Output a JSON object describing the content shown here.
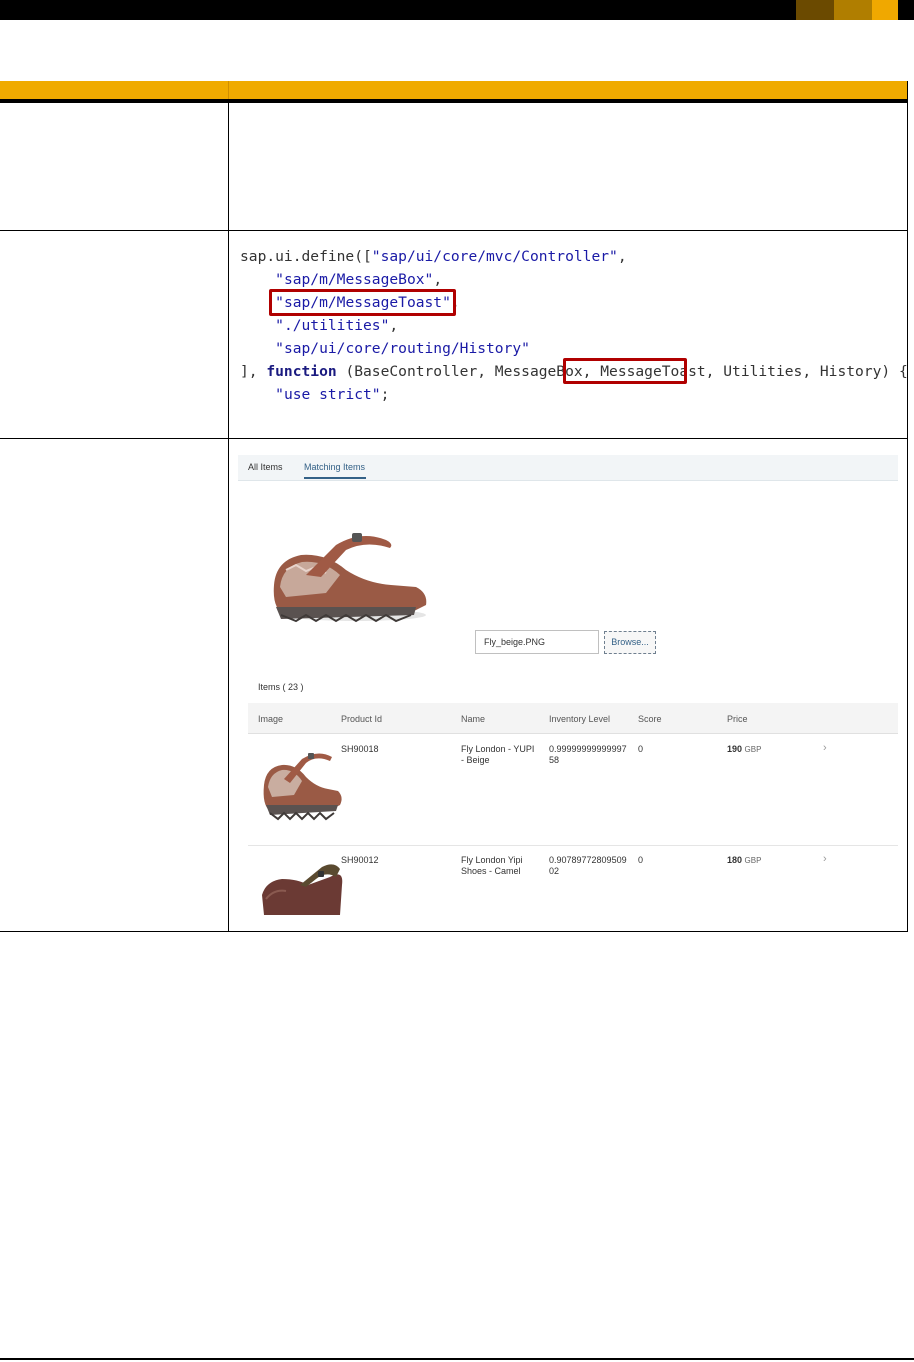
{
  "code": {
    "lines": [
      [
        {
          "t": "sap.ui.define(["
        },
        {
          "t": "\"sap/ui/core/mvc/Controller\"",
          "c": "str"
        },
        {
          "t": ","
        }
      ],
      [
        {
          "t": "    "
        },
        {
          "t": "\"sap/m/MessageBox\"",
          "c": "str"
        },
        {
          "t": ","
        }
      ],
      [
        {
          "t": "    "
        },
        {
          "t": "\"sap/m/MessageToast\"",
          "c": "str"
        },
        {
          "t": ","
        }
      ],
      [
        {
          "t": "    "
        },
        {
          "t": "\"./utilities\"",
          "c": "str"
        },
        {
          "t": ","
        }
      ],
      [
        {
          "t": "    "
        },
        {
          "t": "\"sap/ui/core/routing/History\"",
          "c": "str"
        }
      ],
      [
        {
          "t": "], "
        },
        {
          "t": "function",
          "c": "kw"
        },
        {
          "t": " (BaseController, MessageBox, MessageToast, Utilities, History) {"
        }
      ],
      [
        {
          "t": "    "
        },
        {
          "t": "\"use strict\"",
          "c": "str"
        },
        {
          "t": ";"
        }
      ]
    ]
  },
  "app": {
    "tabs": {
      "all": "All Items",
      "matching": "Matching Items"
    },
    "file_name": "Fly_beige.PNG",
    "browse_label": "Browse...",
    "items_title": "Items (  23  )",
    "columns": {
      "image": "Image",
      "product_id": "Product Id",
      "name": "Name",
      "inventory": "Inventory Level",
      "score": "Score",
      "price": "Price"
    },
    "rows": [
      {
        "product_id": "SH90018",
        "name_1": "Fly London - YUPI",
        "name_2": "- Beige",
        "inv_1": "0.99999999999997",
        "inv_2": "58",
        "score": "0",
        "price": "190",
        "currency": "GBP"
      },
      {
        "product_id": "SH90012",
        "name_1": "Fly London Yipi",
        "name_2": "Shoes - Camel",
        "inv_1": "0.90789772809509",
        "inv_2": "02",
        "score": "0",
        "price": "180",
        "currency": "GBP"
      }
    ]
  },
  "icons": {
    "row_nav": "chevron-right-icon",
    "shoe": "shoe-image"
  }
}
